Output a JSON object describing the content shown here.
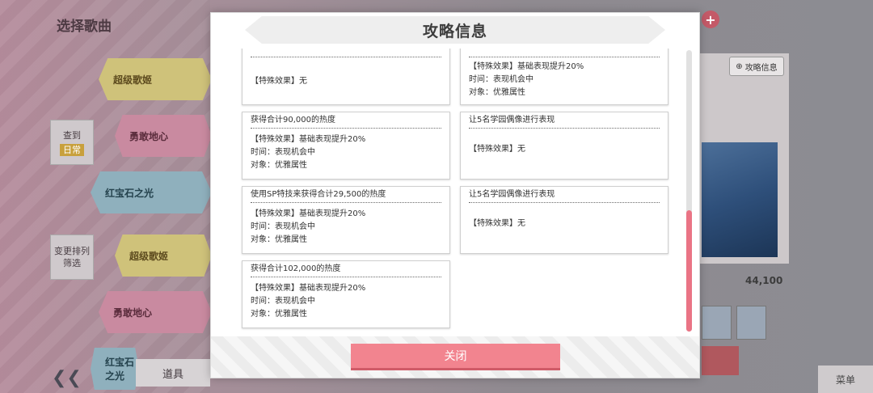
{
  "background": {
    "screen_title": "选择歌曲",
    "side_buttons": [
      {
        "line1": "查到",
        "line2": "日常"
      },
      {
        "line1": "变更排列",
        "line2": "筛选"
      }
    ],
    "songs": [
      "超级歌姬",
      "勇敢地心",
      "红宝石之光",
      "超级歌姬",
      "勇敢地心",
      "红宝石之光"
    ],
    "left_nav_icon": "double-chevron-left-icon",
    "tool_tab_label": "道具",
    "strategy_button_label": "攻略信息",
    "score": "44,100",
    "menu_label": "菜单",
    "plus_icon": "plus-icon"
  },
  "dialog": {
    "title": "攻略信息",
    "left_cards": [
      {
        "title": "",
        "lines": [
          "【特殊效果】无"
        ]
      },
      {
        "title": "获得合计90,000的热度",
        "lines": [
          "【特殊效果】基础表现提升20%",
          "时间：表现机会中",
          "对象：优雅属性"
        ]
      },
      {
        "title": "使用SP特技来获得合计29,500的热度",
        "lines": [
          "【特殊效果】基础表现提升20%",
          "时间：表现机会中",
          "对象：优雅属性"
        ]
      },
      {
        "title": "获得合计102,000的热度",
        "lines": [
          "【特殊效果】基础表现提升20%",
          "时间：表现机会中",
          "对象：优雅属性"
        ]
      }
    ],
    "right_cards": [
      {
        "title": "",
        "lines": [
          "【特殊效果】基础表现提升20%",
          "时间：表现机会中",
          "对象：优雅属性"
        ]
      },
      {
        "title": "让5名学园偶像进行表现",
        "lines": [
          "【特殊效果】无"
        ]
      },
      {
        "title": "让5名学园偶像进行表现",
        "lines": [
          "【特殊效果】无"
        ]
      }
    ],
    "close_label": "关闭"
  },
  "colors": {
    "accent": "#f2848f",
    "scroll_thumb": "#ea7485"
  }
}
